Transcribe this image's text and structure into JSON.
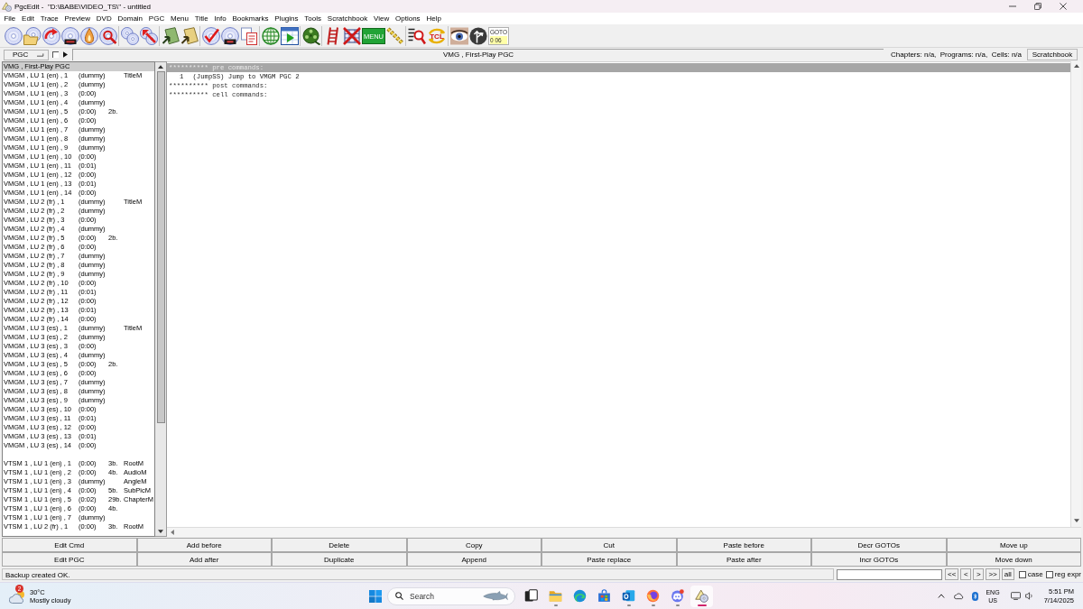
{
  "window": {
    "title": "PgcEdit -  \"D:\\BABE\\VIDEO_TS\\\" - untitled"
  },
  "menu": [
    "File",
    "Edit",
    "Trace",
    "Preview",
    "DVD",
    "Domain",
    "PGC",
    "Menu",
    "Title",
    "Info",
    "Bookmarks",
    "Plugins",
    "Tools",
    "Scratchbook",
    "View",
    "Options",
    "Help"
  ],
  "toolbar": {
    "labels": [
      "MENU",
      "TCL"
    ],
    "goto": {
      "label": "GOTO",
      "value": "0 06"
    }
  },
  "pgc_bar": {
    "domain_select": "PGC",
    "checked": false,
    "current_pgc": "VMG , First-Play PGC",
    "info": "Chapters: n/a,  Programs: n/a,  Cells: n/a",
    "scratchbook_button": "Scratchbook"
  },
  "pgc_list": {
    "groups": [
      {
        "rows": [
          {
            "column_1": "VMG , First-Play PGC",
            "selected": true
          },
          {
            "column_1": "VMGM , LU 1 (en) , 1",
            "column_2": "(dummy)",
            "column_4": "TitleM",
            "selected": false
          },
          {
            "column_1": "VMGM , LU 1 (en) , 2",
            "column_2": "(dummy)",
            "selected": false
          },
          {
            "column_1": "VMGM , LU 1 (en) , 3",
            "column_2": "(0:00)",
            "selected": false
          },
          {
            "column_1": "VMGM , LU 1 (en) , 4",
            "column_2": "(dummy)",
            "selected": false
          },
          {
            "column_1": "VMGM , LU 1 (en) , 5",
            "column_2": "(0:00)",
            "column_3": "2b.",
            "selected": false
          },
          {
            "column_1": "VMGM , LU 1 (en) , 6",
            "column_2": "(0:00)",
            "selected": false
          },
          {
            "column_1": "VMGM , LU 1 (en) , 7",
            "column_2": "(dummy)",
            "selected": false
          },
          {
            "column_1": "VMGM , LU 1 (en) , 8",
            "column_2": "(dummy)",
            "selected": false
          },
          {
            "column_1": "VMGM , LU 1 (en) , 9",
            "column_2": "(dummy)",
            "selected": false
          },
          {
            "column_1": "VMGM , LU 1 (en) , 10",
            "column_2": "(0:00)",
            "selected": false
          },
          {
            "column_1": "VMGM , LU 1 (en) , 11",
            "column_2": "(0:01)",
            "selected": false
          },
          {
            "column_1": "VMGM , LU 1 (en) , 12",
            "column_2": "(0:00)",
            "selected": false
          },
          {
            "column_1": "VMGM , LU 1 (en) , 13",
            "column_2": "(0:01)",
            "selected": false
          },
          {
            "column_1": "VMGM , LU 1 (en) , 14",
            "column_2": "(0:00)",
            "selected": false
          },
          {
            "column_1": "VMGM , LU 2 (fr) , 1",
            "column_2": "(dummy)",
            "column_4": "TitleM",
            "selected": false
          },
          {
            "column_1": "VMGM , LU 2 (fr) , 2",
            "column_2": "(dummy)",
            "selected": false
          },
          {
            "column_1": "VMGM , LU 2 (fr) , 3",
            "column_2": "(0:00)",
            "selected": false
          },
          {
            "column_1": "VMGM , LU 2 (fr) , 4",
            "column_2": "(dummy)",
            "selected": false
          },
          {
            "column_1": "VMGM , LU 2 (fr) , 5",
            "column_2": "(0:00)",
            "column_3": "2b.",
            "selected": false
          },
          {
            "column_1": "VMGM , LU 2 (fr) , 6",
            "column_2": "(0:00)",
            "selected": false
          },
          {
            "column_1": "VMGM , LU 2 (fr) , 7",
            "column_2": "(dummy)",
            "selected": false
          },
          {
            "column_1": "VMGM , LU 2 (fr) , 8",
            "column_2": "(dummy)",
            "selected": false
          },
          {
            "column_1": "VMGM , LU 2 (fr) , 9",
            "column_2": "(dummy)",
            "selected": false
          },
          {
            "column_1": "VMGM , LU 2 (fr) , 10",
            "column_2": "(0:00)",
            "selected": false
          },
          {
            "column_1": "VMGM , LU 2 (fr) , 11",
            "column_2": "(0:01)",
            "selected": false
          },
          {
            "column_1": "VMGM , LU 2 (fr) , 12",
            "column_2": "(0:00)",
            "selected": false
          },
          {
            "column_1": "VMGM , LU 2 (fr) , 13",
            "column_2": "(0:01)",
            "selected": false
          },
          {
            "column_1": "VMGM , LU 2 (fr) , 14",
            "column_2": "(0:00)",
            "selected": false
          },
          {
            "column_1": "VMGM , LU 3 (es) , 1",
            "column_2": "(dummy)",
            "column_4": "TitleM",
            "selected": false
          },
          {
            "column_1": "VMGM , LU 3 (es) , 2",
            "column_2": "(dummy)",
            "selected": false
          },
          {
            "column_1": "VMGM , LU 3 (es) , 3",
            "column_2": "(0:00)",
            "selected": false
          },
          {
            "column_1": "VMGM , LU 3 (es) , 4",
            "column_2": "(dummy)",
            "selected": false
          },
          {
            "column_1": "VMGM , LU 3 (es) , 5",
            "column_2": "(0:00)",
            "column_3": "2b.",
            "selected": false
          },
          {
            "column_1": "VMGM , LU 3 (es) , 6",
            "column_2": "(0:00)",
            "selected": false
          },
          {
            "column_1": "VMGM , LU 3 (es) , 7",
            "column_2": "(dummy)",
            "selected": false
          },
          {
            "column_1": "VMGM , LU 3 (es) , 8",
            "column_2": "(dummy)",
            "selected": false
          },
          {
            "column_1": "VMGM , LU 3 (es) , 9",
            "column_2": "(dummy)",
            "selected": false
          },
          {
            "column_1": "VMGM , LU 3 (es) , 10",
            "column_2": "(0:00)",
            "selected": false
          },
          {
            "column_1": "VMGM , LU 3 (es) , 11",
            "column_2": "(0:01)",
            "selected": false
          },
          {
            "column_1": "VMGM , LU 3 (es) , 12",
            "column_2": "(0:00)",
            "selected": false
          },
          {
            "column_1": "VMGM , LU 3 (es) , 13",
            "column_2": "(0:01)",
            "selected": false
          },
          {
            "column_1": "VMGM , LU 3 (es) , 14",
            "column_2": "(0:00)",
            "selected": false
          }
        ]
      },
      {
        "rows": [
          {
            "column_1": "VTSM 1 , LU 1 (en) , 1",
            "column_2": "(0:00)",
            "column_3": "3b.",
            "column_4": "RootM",
            "selected": false
          },
          {
            "column_1": "VTSM 1 , LU 1 (en) , 2",
            "column_2": "(0:00)",
            "column_3": "4b.",
            "column_4": "AudioM",
            "selected": false
          },
          {
            "column_1": "VTSM 1 , LU 1 (en) , 3",
            "column_2": "(dummy)",
            "column_4": "AngleM",
            "selected": false
          },
          {
            "column_1": "VTSM 1 , LU 1 (en) , 4",
            "column_2": "(0:00)",
            "column_3": "5b.",
            "column_4": "SubPicM",
            "selected": false
          },
          {
            "column_1": "VTSM 1 , LU 1 (en) , 5",
            "column_2": "(0:02)",
            "column_3": "29b.",
            "column_4": "ChapterM",
            "selected": false
          },
          {
            "column_1": "VTSM 1 , LU 1 (en) , 6",
            "column_2": "(0:00)",
            "column_3": "4b.",
            "selected": false
          },
          {
            "column_1": "VTSM 1 , LU 1 (en) , 7",
            "column_2": "(dummy)",
            "selected": false
          },
          {
            "column_1": "VTSM 1 , LU 2 (fr) , 1",
            "column_2": "(0:00)",
            "column_3": "3b.",
            "column_4": "RootM",
            "selected": false
          }
        ]
      }
    ]
  },
  "commands": [
    {
      "kind": "header",
      "text": "********** pre commands:",
      "selected": true
    },
    {
      "kind": "command",
      "number": "1",
      "text": "(JumpSS) Jump to VMGM PGC 2",
      "selected": false
    },
    {
      "kind": "header",
      "text": "********** post commands:",
      "selected": false
    },
    {
      "kind": "header",
      "text": "********** cell commands:",
      "selected": false
    }
  ],
  "buttons": [
    [
      "Edit Cmd",
      "Add before",
      "Delete",
      "Copy",
      "Cut",
      "Paste before",
      "Decr GOTOs",
      "Move up"
    ],
    [
      "Edit PGC",
      "Add after",
      "Duplicate",
      "Append",
      "Paste replace",
      "Paste after",
      "Incr GOTOs",
      "Move down"
    ]
  ],
  "status_bar": {
    "message": "Backup created OK.",
    "nav_buttons": [
      "<<",
      "<",
      ">",
      ">>",
      "all"
    ],
    "options": [
      {
        "label": "case",
        "checked": false
      },
      {
        "label": "reg expr",
        "checked": false
      }
    ]
  },
  "taskbar": {
    "weather": {
      "badge": "2",
      "temperature": "30°C",
      "condition": "Mostly cloudy"
    },
    "search": {
      "placeholder": "Search"
    },
    "apps": [
      {
        "running": false,
        "selected": false
      },
      {
        "running": true,
        "selected": false
      },
      {
        "running": false,
        "selected": false
      },
      {
        "running": false,
        "selected": false
      },
      {
        "running": true,
        "selected": false
      },
      {
        "running": true,
        "selected": false
      },
      {
        "running": true,
        "selected": false
      },
      {
        "running": true,
        "selected": true
      }
    ],
    "language": "ENG",
    "region": "US",
    "time": "5:51 PM",
    "date": "7/14/2025"
  }
}
